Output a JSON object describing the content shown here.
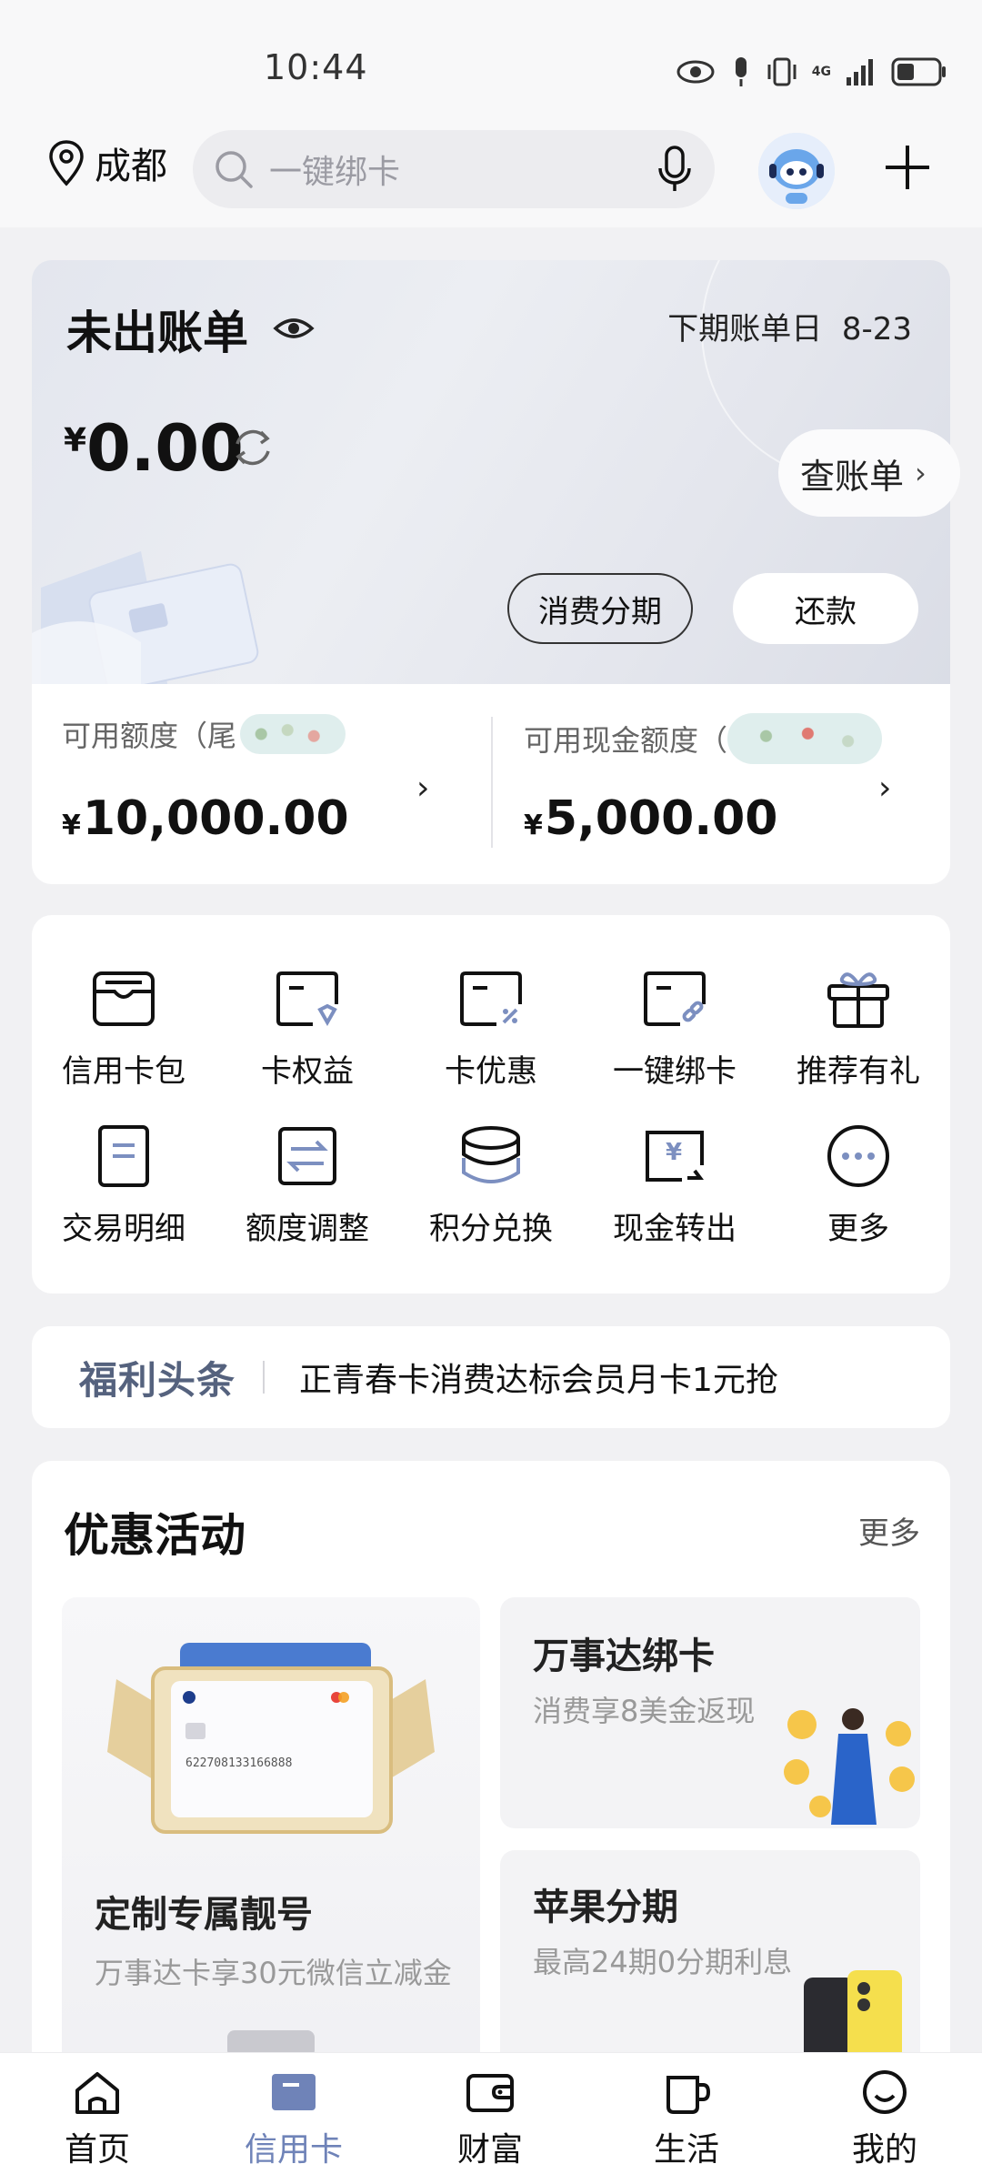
{
  "status": {
    "time": "10:44",
    "network": "4G"
  },
  "header": {
    "city": "成都",
    "search_placeholder": "一键绑卡"
  },
  "bill": {
    "title": "未出账单",
    "next_bill_label": "下期账单日",
    "next_bill_date": "8-23",
    "currency": "¥",
    "amount": "0.00",
    "view_bill": "查账单",
    "installment": "消费分期",
    "repay": "还款"
  },
  "limits": {
    "available_label": "可用额度（尾",
    "available_value": "10,000.00",
    "cash_label": "可用现金额度（",
    "cash_value": "5,000.00",
    "currency": "¥"
  },
  "grid": [
    {
      "label": "信用卡包",
      "icon": "card-wallet-icon"
    },
    {
      "label": "卡权益",
      "icon": "card-benefit-icon"
    },
    {
      "label": "卡优惠",
      "icon": "card-discount-icon"
    },
    {
      "label": "一键绑卡",
      "icon": "card-bind-icon"
    },
    {
      "label": "推荐有礼",
      "icon": "gift-icon"
    },
    {
      "label": "交易明细",
      "icon": "transaction-detail-icon"
    },
    {
      "label": "额度调整",
      "icon": "limit-adjust-icon"
    },
    {
      "label": "积分兑换",
      "icon": "points-exchange-icon"
    },
    {
      "label": "现金转出",
      "icon": "cash-transfer-icon"
    },
    {
      "label": "更多",
      "icon": "more-icon"
    }
  ],
  "news": {
    "brand": "福利头条",
    "text": "正青春卡消费达标会员月卡1元抢"
  },
  "promo": {
    "title": "优惠活动",
    "more": "更多",
    "left": {
      "title": "定制专属靓号",
      "sub": "万事达卡享30元微信立减金",
      "card_number": "622708133166888"
    },
    "right1": {
      "title": "万事达绑卡",
      "sub": "消费享8美金返现"
    },
    "right2": {
      "title": "苹果分期",
      "sub": "最高24期0分期利息"
    }
  },
  "tabs": [
    {
      "label": "首页",
      "icon": "home-icon"
    },
    {
      "label": "信用卡",
      "icon": "credit-card-icon"
    },
    {
      "label": "财富",
      "icon": "wallet-icon"
    },
    {
      "label": "生活",
      "icon": "cup-icon"
    },
    {
      "label": "我的",
      "icon": "profile-icon"
    }
  ],
  "colors": {
    "accent": "#6f83b8",
    "news_brand": "#55627e"
  }
}
